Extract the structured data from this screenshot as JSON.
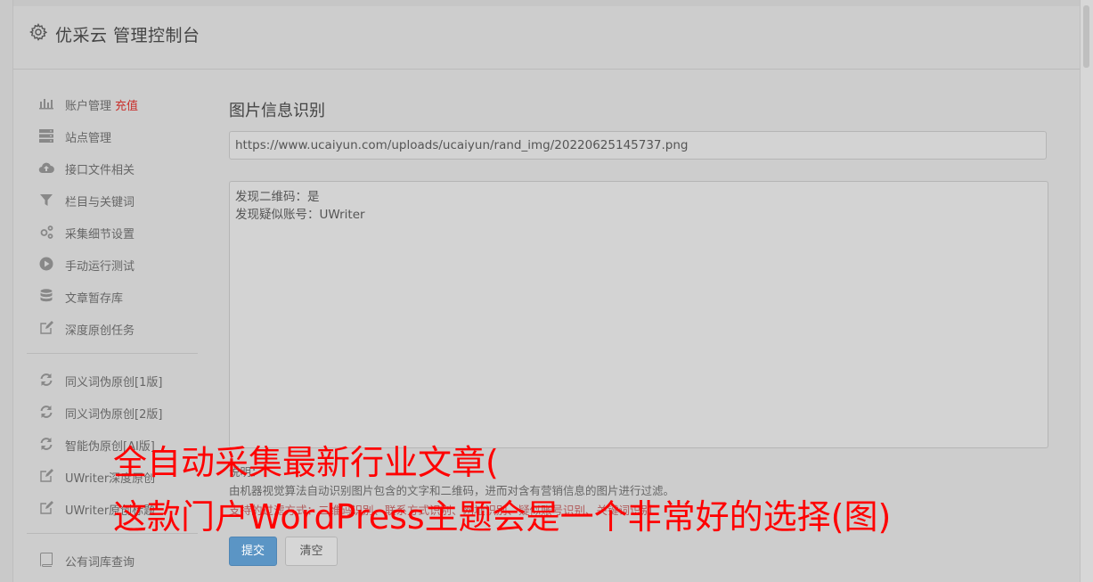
{
  "header": {
    "title": "优采云 管理控制台",
    "icon": "gear-icon"
  },
  "sidebar": {
    "groups": [
      [
        {
          "label": "账户管理",
          "extra": "充值",
          "icon": "bar-chart-icon"
        },
        {
          "label": "站点管理",
          "icon": "server-icon"
        },
        {
          "label": "接口文件相关",
          "icon": "cloud-upload-icon"
        },
        {
          "label": "栏目与关键词",
          "icon": "filter-icon"
        },
        {
          "label": "采集细节设置",
          "icon": "cogs-icon"
        },
        {
          "label": "手动运行测试",
          "icon": "play-circle-icon"
        },
        {
          "label": "文章暂存库",
          "icon": "database-icon"
        },
        {
          "label": "深度原创任务",
          "icon": "edit-icon"
        }
      ],
      [
        {
          "label": "同义词伪原创[1版]",
          "icon": "refresh-icon"
        },
        {
          "label": "同义词伪原创[2版]",
          "icon": "refresh-icon"
        },
        {
          "label": "智能伪原创[AI版]",
          "icon": "refresh-icon"
        },
        {
          "label": "UWriter深度原创",
          "icon": "edit-icon"
        },
        {
          "label": "UWriter原创标题",
          "icon": "edit-icon"
        }
      ],
      [
        {
          "label": "公有词库查询",
          "icon": "book-icon"
        }
      ]
    ]
  },
  "main": {
    "title": "图片信息识别",
    "url_value": "https://www.ucaiyun.com/uploads/ucaiyun/rand_img/20220625145737.png",
    "result_lines": [
      "发现二维码：是",
      "发现疑似账号：UWriter"
    ],
    "desc_label": "说明：",
    "desc_text": "由机器视觉算法自动识别图片包含的文字和二维码，进而对含有营销信息的图片进行过滤。",
    "filters_text": "支持的过滤方式：二维码识别、联系方式识别、网址识别、疑似账号识别、关键词识别",
    "submit_label": "提交",
    "clear_label": "清空"
  },
  "overlay": {
    "line1": "全自动采集最新行业文章(",
    "line2": "这款门户WordPress主题会是一个非常好的选择(图)",
    "color": "#ff0000"
  }
}
